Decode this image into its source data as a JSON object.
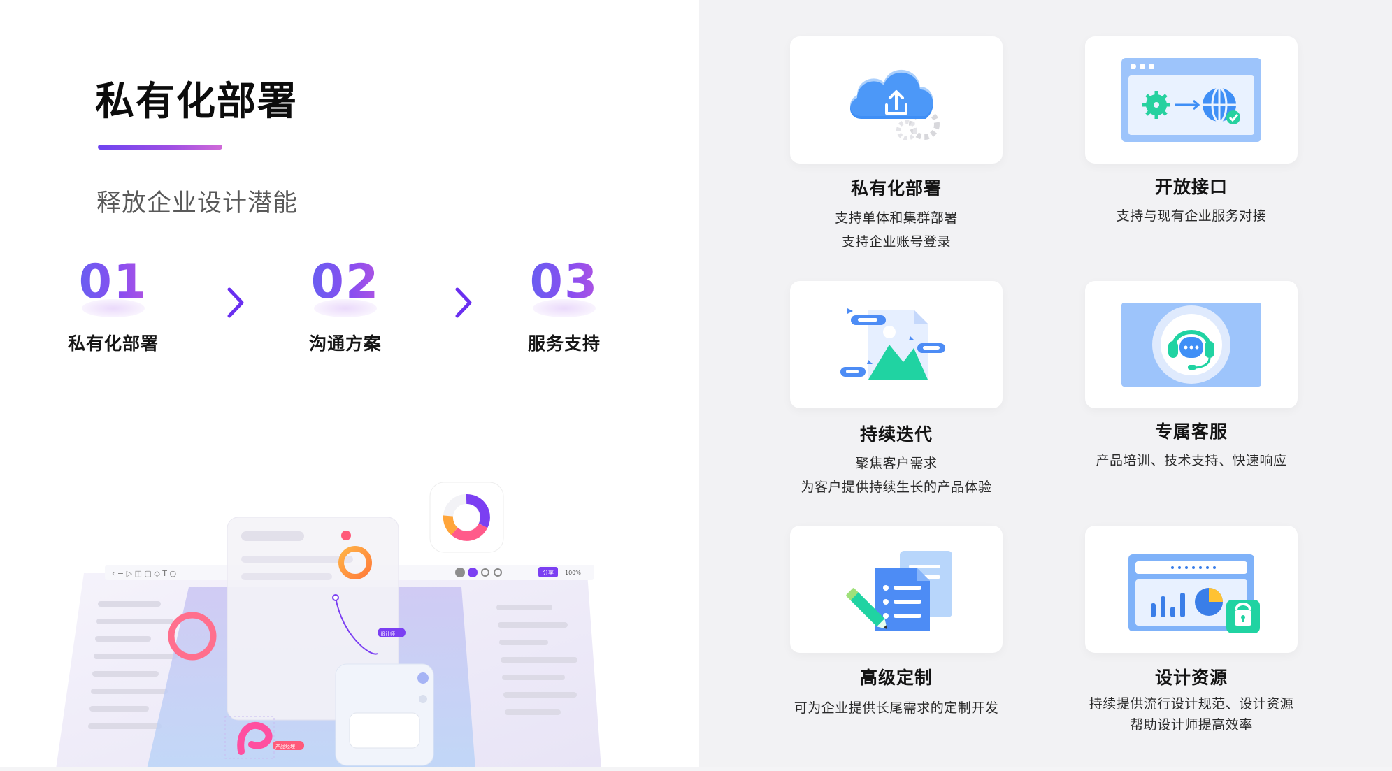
{
  "hero": {
    "title": "私有化部署",
    "subtitle": "释放企业设计潜能"
  },
  "steps": [
    {
      "num": "01",
      "label": "私有化部署"
    },
    {
      "num": "02",
      "label": "沟通方案"
    },
    {
      "num": "03",
      "label": "服务支持"
    }
  ],
  "features": [
    {
      "title": "私有化部署",
      "lines": [
        "支持单体和集群部署",
        "支持企业账号登录"
      ],
      "icon": "cloud-upload-icon"
    },
    {
      "title": "开放接口",
      "lines": [
        "支持与现有企业服务对接"
      ],
      "icon": "api-connect-icon"
    },
    {
      "title": "持续迭代",
      "lines": [
        "聚焦客户需求",
        "为客户提供持续生长的产品体验"
      ],
      "icon": "image-document-icon"
    },
    {
      "title": "专属客服",
      "lines": [
        "产品培训、技术支持、快速响应"
      ],
      "icon": "headset-support-icon"
    },
    {
      "title": "高级定制",
      "lines": [
        "可为企业提供长尾需求的定制开发"
      ],
      "icon": "custom-document-icon"
    },
    {
      "title": "设计资源",
      "lines": [
        "持续提供流行设计规范、设计资源",
        "帮助设计师提高效率"
      ],
      "icon": "design-resource-icon"
    }
  ],
  "illustration": {
    "tag_designer": "设计师",
    "tag_product": "产品经理",
    "zoom": "100%",
    "share": "分享"
  },
  "colors": {
    "accent_blue": "#4d8cf5",
    "accent_green": "#20d3a2",
    "accent_purple": "#7b3ff2"
  }
}
